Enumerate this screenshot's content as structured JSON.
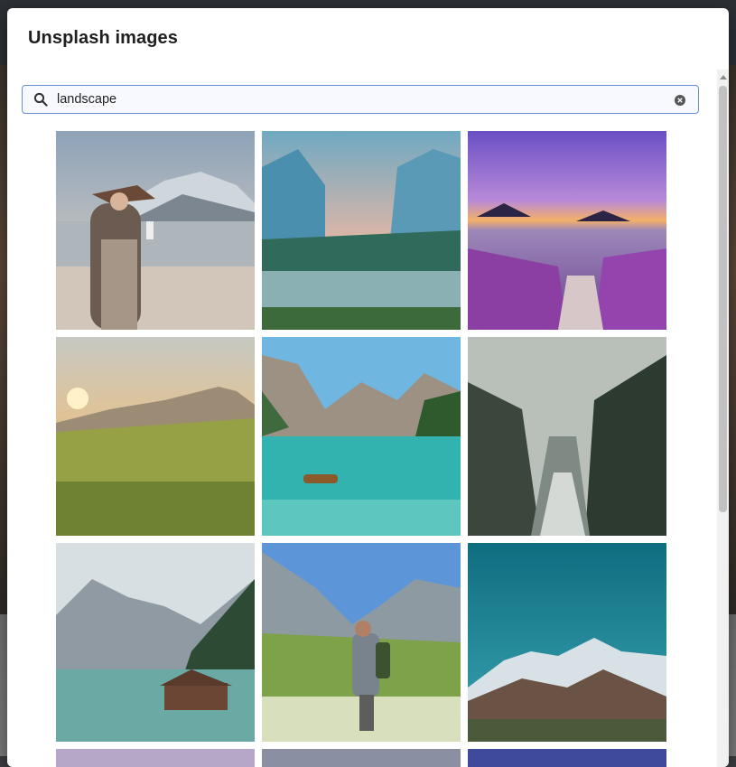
{
  "modal": {
    "title": "Unsplash images"
  },
  "search": {
    "value": "landscape",
    "icon": "search-icon",
    "clear_icon": "clear-icon"
  },
  "images": [
    {
      "name": "image-woman-hat-lake"
    },
    {
      "name": "image-misty-valley-river"
    },
    {
      "name": "image-purple-flowers-lake"
    },
    {
      "name": "image-sunset-meadow"
    },
    {
      "name": "image-turquoise-lake-boat"
    },
    {
      "name": "image-foggy-forest-river"
    },
    {
      "name": "image-mountain-lake-cabin"
    },
    {
      "name": "image-hiker-drinking"
    },
    {
      "name": "image-snowy-mountains-teal-sky"
    },
    {
      "name": "image-partial-1"
    },
    {
      "name": "image-partial-2"
    },
    {
      "name": "image-partial-3"
    }
  ]
}
